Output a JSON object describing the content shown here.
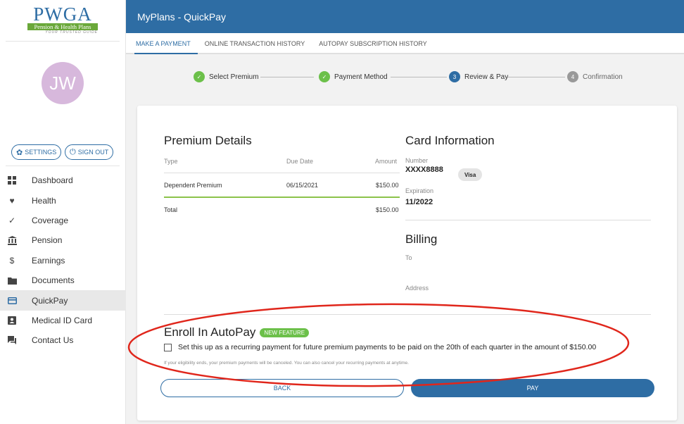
{
  "logo": {
    "name": "PWGA",
    "subtitle": "Pension & Health Plans",
    "tagline": "YOUR TRUSTED GUIDE"
  },
  "user": {
    "initials": "JW"
  },
  "sidebar": {
    "settings_label": "SETTINGS",
    "signout_label": "SIGN OUT",
    "items": [
      {
        "label": "Dashboard",
        "icon": "dashboard-icon"
      },
      {
        "label": "Health",
        "icon": "heart-icon"
      },
      {
        "label": "Coverage",
        "icon": "check-icon"
      },
      {
        "label": "Pension",
        "icon": "bank-icon"
      },
      {
        "label": "Earnings",
        "icon": "dollar-icon"
      },
      {
        "label": "Documents",
        "icon": "folder-icon"
      },
      {
        "label": "QuickPay",
        "icon": "credit-card-icon",
        "active": true
      },
      {
        "label": "Medical ID Card",
        "icon": "id-card-icon"
      },
      {
        "label": "Contact Us",
        "icon": "chat-icon"
      }
    ]
  },
  "header": {
    "title": "MyPlans - QuickPay"
  },
  "tabs": [
    {
      "label": "MAKE A PAYMENT",
      "active": true
    },
    {
      "label": "ONLINE TRANSACTION HISTORY"
    },
    {
      "label": "AUTOPAY SUBSCRIPTION HISTORY"
    }
  ],
  "stepper": [
    {
      "label": "Select Premium",
      "status": "done"
    },
    {
      "label": "Payment Method",
      "status": "done"
    },
    {
      "label": "Review & Pay",
      "number": "3",
      "status": "current"
    },
    {
      "label": "Confirmation",
      "number": "4",
      "status": "pending"
    }
  ],
  "premium": {
    "title": "Premium Details",
    "headers": {
      "type": "Type",
      "due": "Due Date",
      "amount": "Amount"
    },
    "row": {
      "type": "Dependent Premium",
      "due": "06/15/2021",
      "amount": "$150.00"
    },
    "total_label": "Total",
    "total_amount": "$150.00"
  },
  "card_info": {
    "title": "Card Information",
    "number_label": "Number",
    "number": "XXXX8888",
    "brand": "Visa",
    "expiration_label": "Expiration",
    "expiration": "11/2022"
  },
  "billing": {
    "title": "Billing",
    "to_label": "To",
    "address_label": "Address"
  },
  "autopay": {
    "title": "Enroll In AutoPay",
    "badge": "NEW FEATURE",
    "checkbox_label": "Set this up as a recurring payment for future premium payments to be paid on the 20th of each quarter in the amount of $150.00",
    "note": "If your eligibility ends, your premium payments will be canceled. You can also cancel your recurring payments at anytime."
  },
  "actions": {
    "back_label": "BACK",
    "pay_label": "PAY"
  },
  "colors": {
    "primary": "#2e6da4",
    "success": "#6cc04a",
    "highlight": "#e0261b",
    "avatar": "#d7b8dc"
  }
}
